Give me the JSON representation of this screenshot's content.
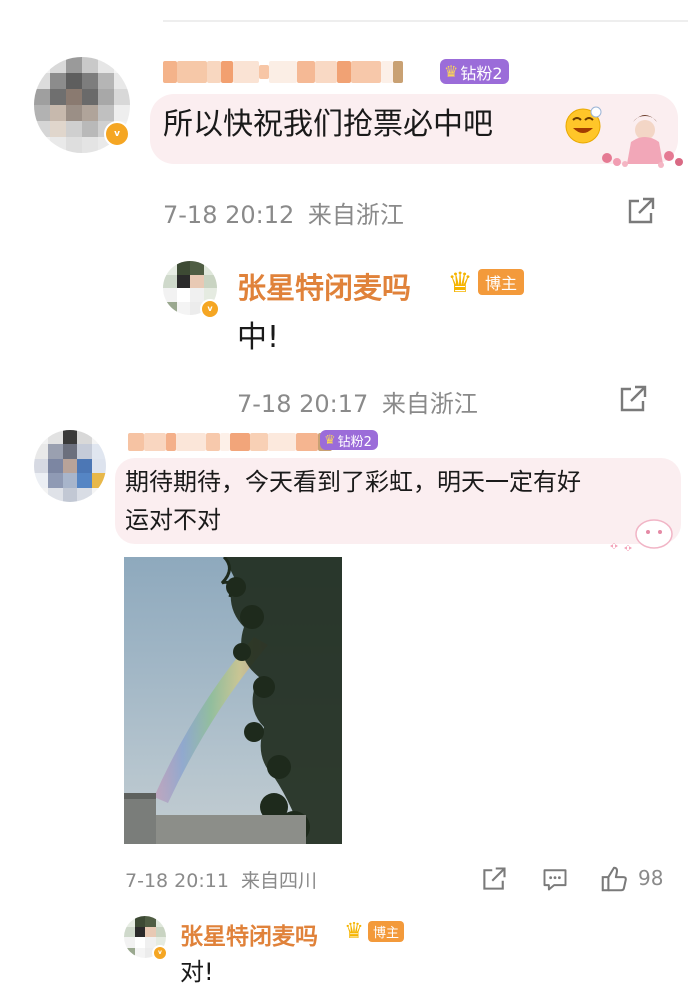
{
  "comments": [
    {
      "fan_badge": "钻粉2",
      "text": "所以快祝我们抢票必中吧",
      "time": "7-18 20:12",
      "location": "来自浙江",
      "reply": {
        "nickname": "张星特闭麦吗",
        "badge": "博主",
        "text": "中!",
        "time": "7-18 20:17",
        "location": "来自浙江"
      }
    },
    {
      "fan_badge": "钻粉2",
      "text_line1": "期待期待，今天看到了彩虹，明天一定有好",
      "text_line2": "运对不对",
      "time": "7-18 20:11",
      "location": "来自四川",
      "likes": "98",
      "reply": {
        "nickname": "张星特闭麦吗",
        "badge": "博主",
        "text": "对!"
      }
    }
  ],
  "icons": [
    "share-icon",
    "comment-icon",
    "like-icon",
    "crown-icon",
    "verified-icon",
    "emoji-icon"
  ]
}
